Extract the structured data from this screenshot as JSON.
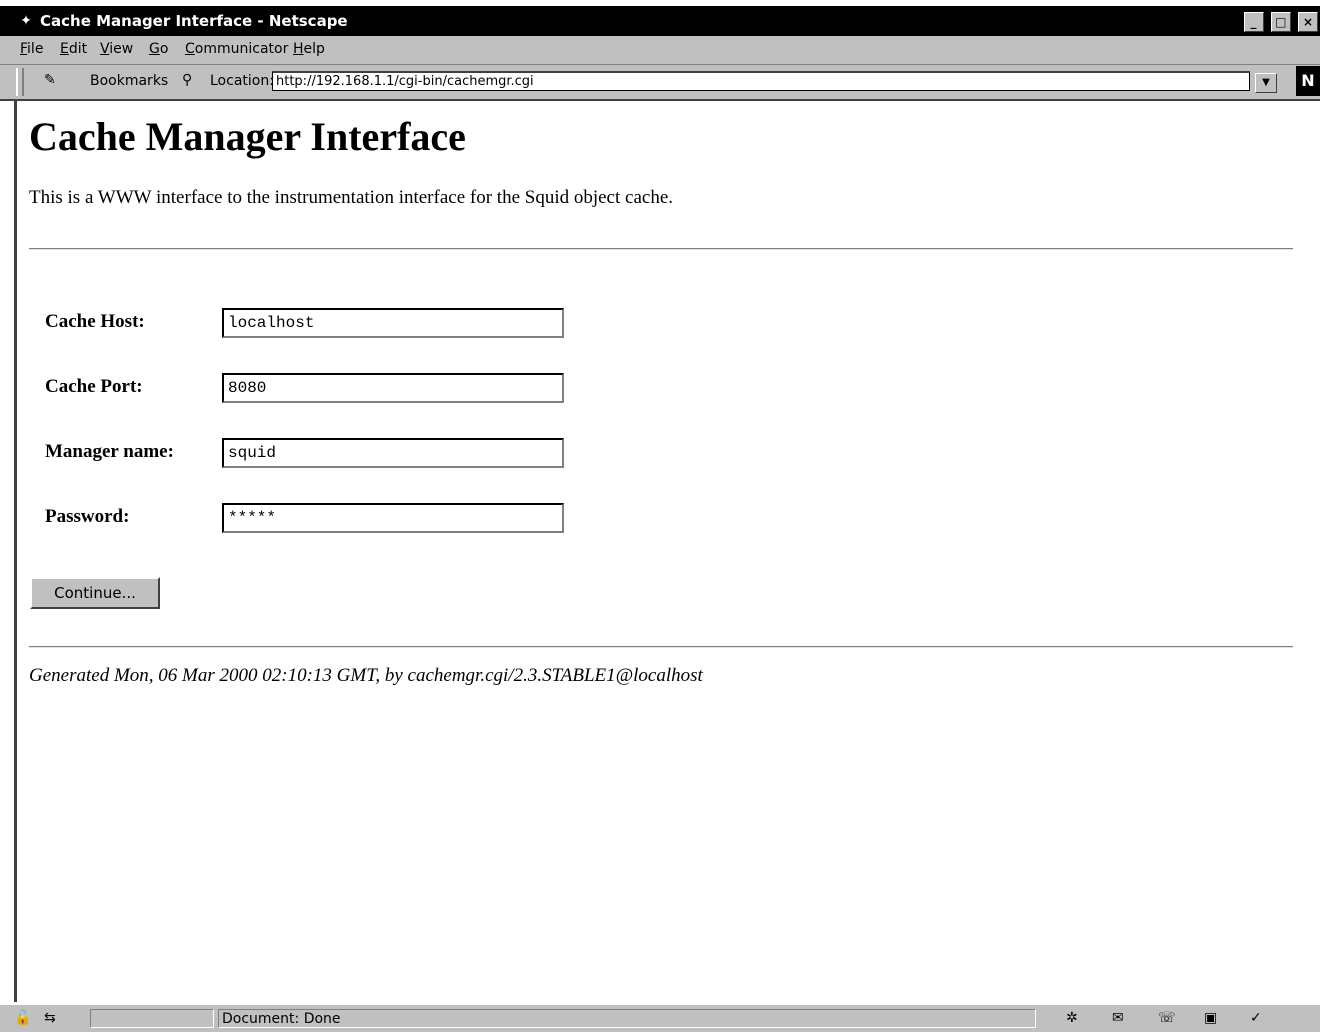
{
  "window": {
    "title": "Cache Manager Interface - Netscape",
    "app_icon": "netscape-icon",
    "buttons": {
      "minimize": "_",
      "maximize": "□",
      "close": "×"
    }
  },
  "menubar": {
    "file": {
      "accel": "F",
      "rest": "ile"
    },
    "edit": {
      "accel": "E",
      "rest": "dit"
    },
    "view": {
      "accel": "V",
      "rest": "iew"
    },
    "go": {
      "accel": "G",
      "rest": "o"
    },
    "communicator": {
      "accel": "C",
      "rest": "ommunicator"
    },
    "help": {
      "accel": "H",
      "rest": "elp"
    }
  },
  "toolbar": {
    "bookmarks_label": "Bookmarks",
    "location_label": "Location:",
    "url": "http://192.168.1.1/cgi-bin/cachemgr.cgi",
    "logo": "N"
  },
  "page": {
    "heading": "Cache Manager Interface",
    "intro": "This is a WWW interface to the instrumentation interface for the Squid object cache.",
    "fields": {
      "host": {
        "label": "Cache Host:",
        "value": "localhost"
      },
      "port": {
        "label": "Cache Port:",
        "value": "8080"
      },
      "manager": {
        "label": "Manager name:",
        "value": "squid"
      },
      "password": {
        "label": "Password:",
        "value": "*****"
      }
    },
    "continue_label": "Continue...",
    "footer": "Generated Mon, 06 Mar 2000 02:10:13 GMT, by cachemgr.cgi/2.3.STABLE1@localhost"
  },
  "status": {
    "text": "Document: Done"
  },
  "colors": {
    "titlebar": "#000000",
    "chrome": "#c0c0c0",
    "page_background": "#ffffff"
  }
}
